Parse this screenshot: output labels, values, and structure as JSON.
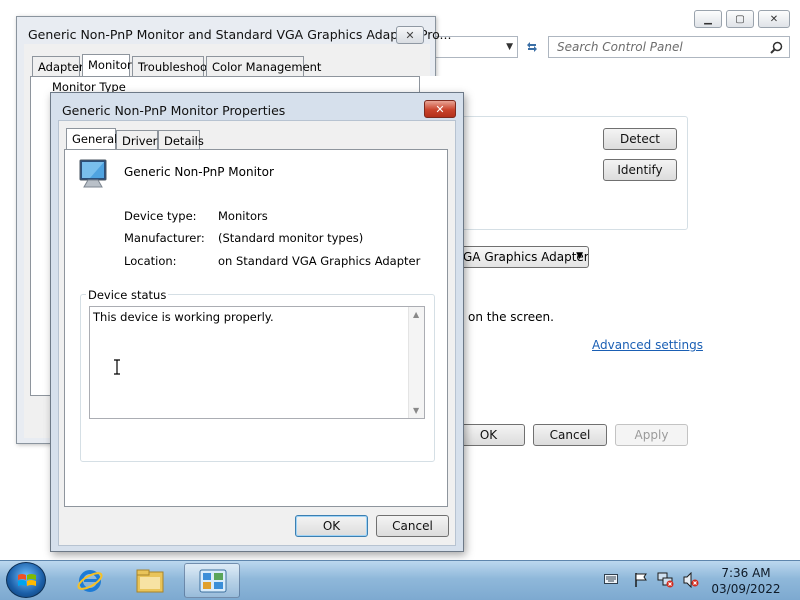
{
  "control_panel": {
    "search_placeholder": "Search Control Panel",
    "refresh_icon": "refresh-icon",
    "caption_buttons": [
      "minimize",
      "maximize",
      "close"
    ],
    "monitor_tab": {
      "detect_label": "Detect",
      "identify_label": "Identify",
      "adapter_combo_value": "GA Graphics Adapter",
      "screen_text": "on the screen.",
      "advanced_link": "Advanced settings"
    },
    "footer": {
      "ok_label": "OK",
      "cancel_label": "Cancel",
      "apply_label": "Apply"
    }
  },
  "adapter_dialog": {
    "title": "Generic Non-PnP Monitor and Standard VGA Graphics Adapter Pro...",
    "close_glyph": "✕",
    "tabs": [
      {
        "label": "Adapter"
      },
      {
        "label": "Monitor"
      },
      {
        "label": "Troubleshoot"
      },
      {
        "label": "Color Management"
      }
    ],
    "monitor_type_label": "Monitor Type"
  },
  "monitor_dialog": {
    "title": "Generic Non-PnP Monitor Properties",
    "close_glyph": "✕",
    "tabs": [
      {
        "label": "General"
      },
      {
        "label": "Driver"
      },
      {
        "label": "Details"
      }
    ],
    "device_name": "Generic Non-PnP Monitor",
    "fields": [
      {
        "label": "Device type:",
        "value": "Monitors"
      },
      {
        "label": "Manufacturer:",
        "value": "(Standard monitor types)"
      },
      {
        "label": "Location:",
        "value": "on Standard VGA Graphics Adapter"
      }
    ],
    "status_group_label": "Device status",
    "status_text": "This device is working properly.",
    "ok_label": "OK",
    "cancel_label": "Cancel"
  },
  "taskbar": {
    "time": "7:36 AM",
    "date": "03/09/2022"
  },
  "colors": {
    "taskbar": "#8fb8da",
    "link": "#1a5fb4",
    "close_red": "#c9442c"
  }
}
